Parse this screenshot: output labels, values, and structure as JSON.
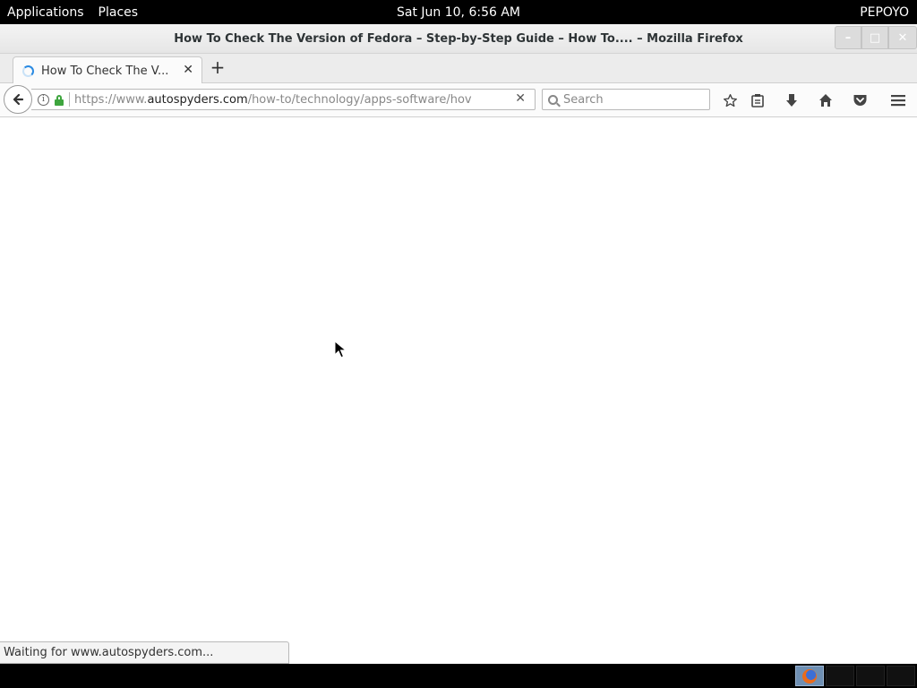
{
  "topbar": {
    "applications": "Applications",
    "places": "Places",
    "clock": "Sat Jun 10,  6:56 AM",
    "user": "PEPOYO"
  },
  "window": {
    "title": "How To Check The Version of Fedora – Step-by-Step Guide – How To.... – Mozilla Firefox",
    "minimize": "–",
    "maximize": "□",
    "close": "✕"
  },
  "tabs": [
    {
      "title": "How To Check The V...",
      "close": "✕",
      "loading": true
    }
  ],
  "newtab": "+",
  "urlbar": {
    "scheme_prefix": "https://www.",
    "host": "autospyders.com",
    "path": "/how-to/technology/apps-software/hov",
    "clear": "✕"
  },
  "search": {
    "placeholder": "Search"
  },
  "toolbar": {
    "bookmark": "☆",
    "reading_list": "☰",
    "downloads": "⬇",
    "home": "⌂",
    "pocket": "◡",
    "menu": "≡"
  },
  "status": "Waiting for www.autospyders.com...",
  "taskbar": {
    "firefox_icon": "firefox-icon"
  }
}
